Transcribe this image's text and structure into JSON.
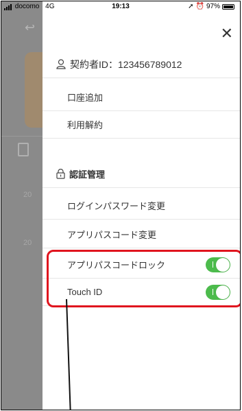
{
  "status_bar": {
    "carrier": "docomo",
    "network": "4G",
    "time": "19:13",
    "battery": "97%"
  },
  "background": {
    "numbers": [
      "20",
      "20"
    ]
  },
  "drawer": {
    "close_icon": "close-icon",
    "contract_id": "契約者ID：123456789012",
    "items_account": [
      "口座追加",
      "利用解約"
    ],
    "auth_header": "認証管理",
    "items_auth": [
      "ログインパスワード変更",
      "アプリパスコード変更"
    ],
    "toggles": [
      {
        "label": "アプリパスコードロック",
        "on": true
      },
      {
        "label": "Touch ID",
        "on": true
      }
    ]
  },
  "colors": {
    "toggle_on": "#4cbb4c",
    "highlight": "#e0141e"
  }
}
